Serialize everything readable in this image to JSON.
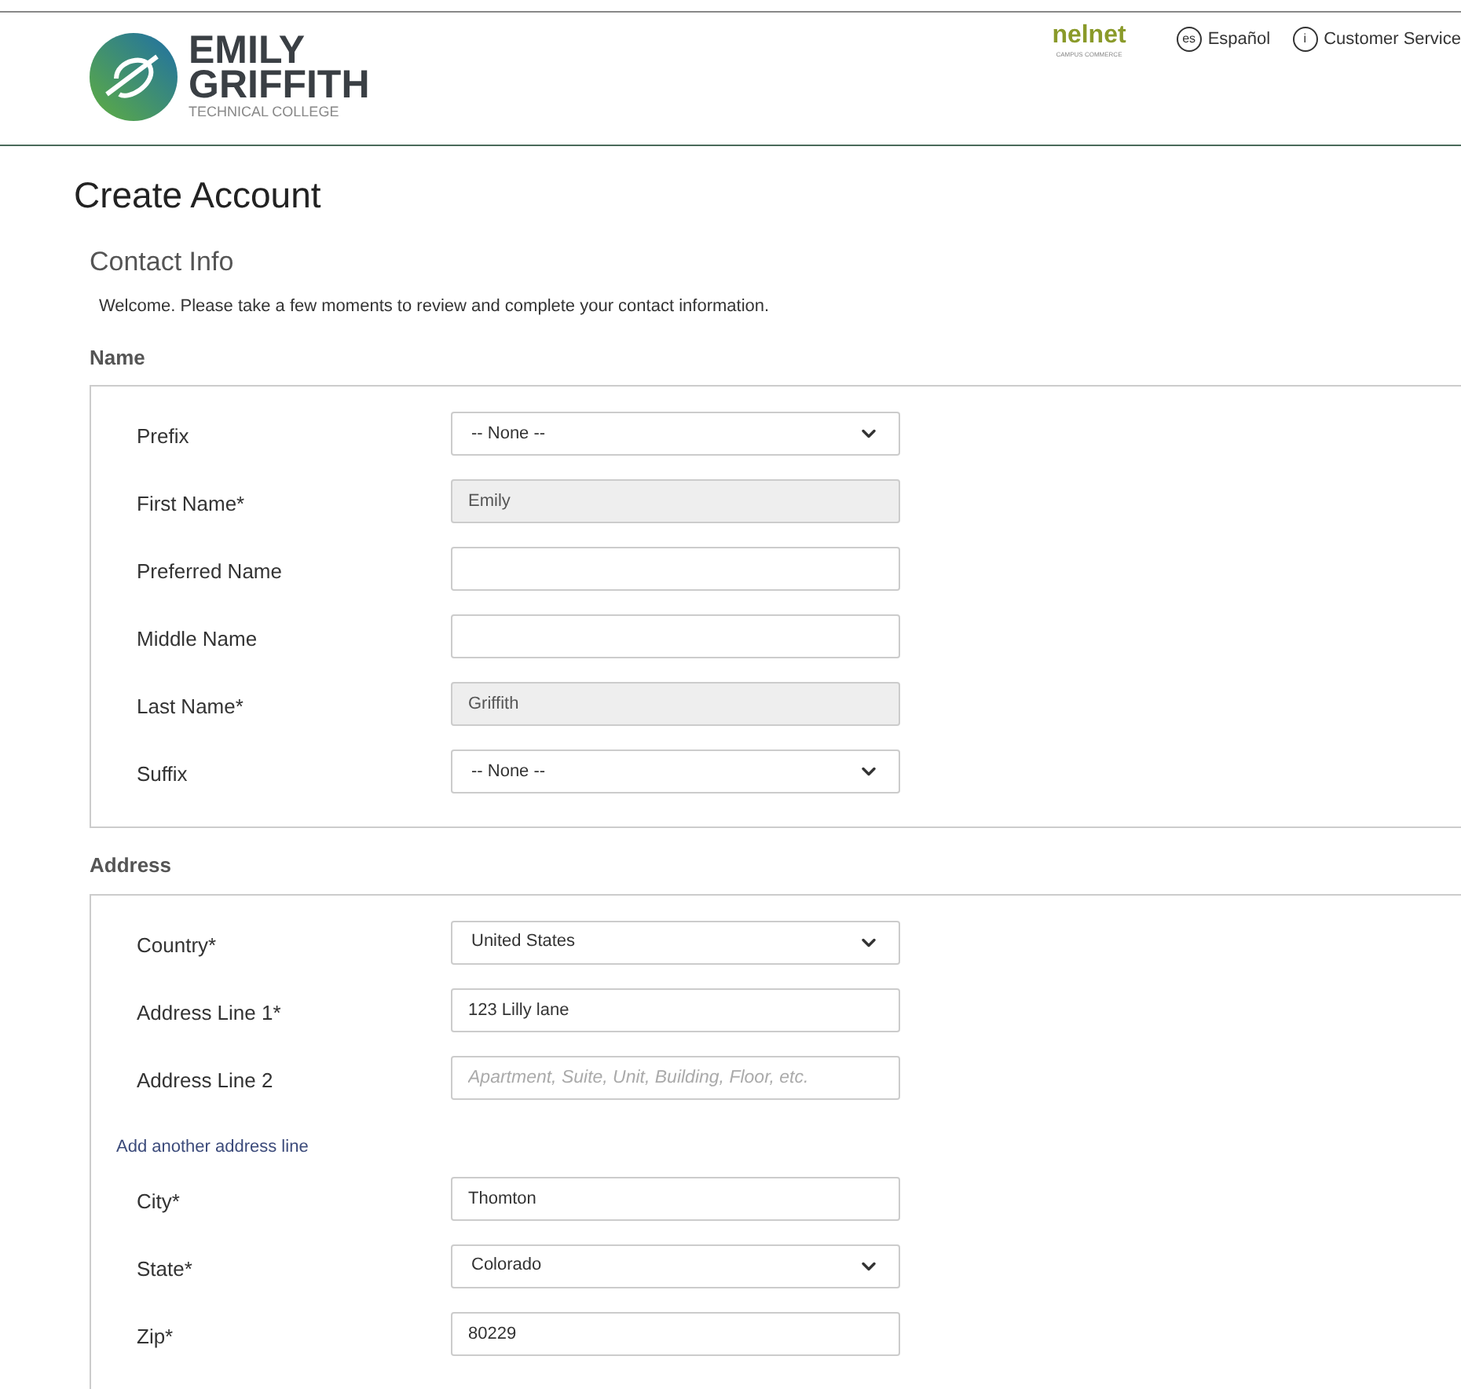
{
  "header": {
    "logo": {
      "line1": "EMILY",
      "line2": "GRIFFITH",
      "line3": "TECHNICAL COLLEGE"
    },
    "partner": {
      "name": "nelnet",
      "tagline": "CAMPUS COMMERCE"
    },
    "links": [
      {
        "badge": "es",
        "label": "Español"
      },
      {
        "badge": "i",
        "label": "Customer Service"
      }
    ]
  },
  "page_title": "Create Account",
  "section_title": "Contact Info",
  "intro": "Welcome. Please take a few moments to review and complete your contact information.",
  "groups": [
    {
      "title": "Name",
      "rows": [
        {
          "kind": "select",
          "label": "Prefix",
          "value": "-- None --"
        },
        {
          "kind": "input",
          "label": "First Name*",
          "value": "Emily",
          "disabled": true
        },
        {
          "kind": "input",
          "label": "Preferred Name",
          "disabled": false
        },
        {
          "kind": "input",
          "label": "Middle Name",
          "disabled": false
        },
        {
          "kind": "input",
          "label": "Last Name*",
          "value": "Griffith",
          "disabled": true
        },
        {
          "kind": "select",
          "label": "Suffix",
          "value": "-- None --"
        }
      ]
    },
    {
      "title": "Address",
      "rows": [
        {
          "kind": "select",
          "label": "Country*",
          "value": "United States"
        },
        {
          "kind": "input",
          "label": "Address Line 1*",
          "value": "123 Lilly lane",
          "disabled": false
        },
        {
          "kind": "input",
          "label": "Address Line 2",
          "placeholder": "Apartment, Suite, Unit, Building, Floor, etc.",
          "disabled": false
        },
        {
          "kind": "link",
          "label": "Add another address line"
        },
        {
          "kind": "input",
          "label": "City*",
          "value": "Thomton",
          "disabled": false
        },
        {
          "kind": "select",
          "label": "State*",
          "value": "Colorado"
        },
        {
          "kind": "input",
          "label": "Zip*",
          "value": "80229",
          "disabled": false
        }
      ]
    }
  ]
}
